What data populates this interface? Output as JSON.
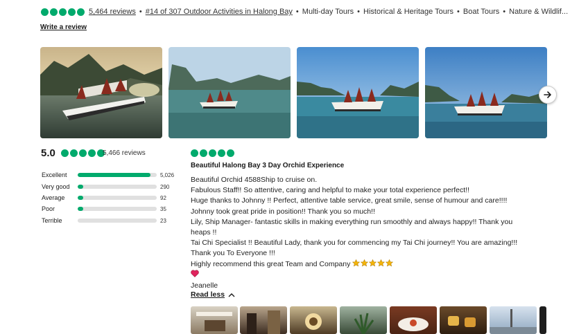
{
  "summary": {
    "reviews_link": "5,464 reviews",
    "rank_link": "#14 of 307 Outdoor Activities in Halong Bay",
    "categories": [
      "Multi-day Tours",
      "Historical & Heritage Tours",
      "Boat Tours",
      "Nature & Wildlif..."
    ],
    "separator": "•",
    "write_review": "Write a review"
  },
  "colors": {
    "accent": "#00aa6c",
    "track": "#e0e0e0",
    "heart": "#e0245e",
    "star": "#f5b50a"
  },
  "photos": [
    {
      "icon": "cruise-ship-sunset-photo"
    },
    {
      "icon": "cruise-ship-bay-photo"
    },
    {
      "icon": "cruise-ship-bay-photo"
    },
    {
      "icon": "cruise-ship-bay-photo"
    }
  ],
  "rating": {
    "score": "5.0",
    "count_label": "5,466 reviews",
    "bubbles": 5,
    "breakdown": [
      {
        "label": "Excellent",
        "count": "5,026",
        "fraction": 0.92
      },
      {
        "label": "Very good",
        "count": "290",
        "fraction": 0.053
      },
      {
        "label": "Average",
        "count": "92",
        "fraction": 0.017
      },
      {
        "label": "Poor",
        "count": "35",
        "fraction": 0.006
      },
      {
        "label": "Terrible",
        "count": "23",
        "fraction": 0.0
      }
    ]
  },
  "review": {
    "bubbles": 5,
    "title": "Beautiful Halong Bay 3 Day Orchid Experience",
    "lines": [
      "Beautiful Orchid 4588Ship to cruise on.",
      "Fabulous Staff!! So attentive, caring and helpful to make your total experience perfect!!",
      "Huge thanks to Johnny !! Perfect, attentive table service, great smile, sense of humour and care!!!!",
      "Johnny took great pride in position!! Thank you so much!!",
      "Lily, Ship Manager- fantastic skills in making everything run smoothly and always happy!! Thank you",
      "heaps !!",
      "Tai Chi Specialist !! Beautiful Lady, thank you for commencing my Tai Chi journey!! You are amazing!!!",
      "Thank you To Everyone !!!",
      "Highly recommend this great Team and Company"
    ],
    "star_emoji_count": 5,
    "signature": "Jeanelle",
    "read_less": "Read less"
  }
}
